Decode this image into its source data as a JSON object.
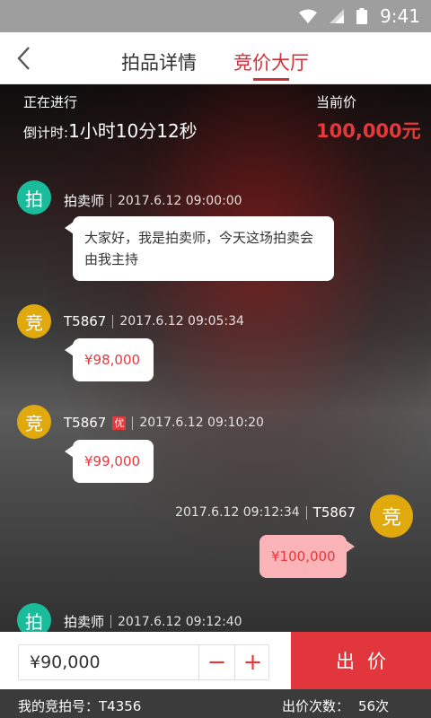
{
  "status_bar": {
    "time": "9:41",
    "icons": [
      "wifi-icon",
      "signal-icon",
      "battery-icon"
    ]
  },
  "nav": {
    "tabs": [
      {
        "label": "拍品详情",
        "active": false
      },
      {
        "label": "竞价大厅",
        "active": true
      }
    ]
  },
  "auction": {
    "status": "正在进行",
    "countdown_label": "倒计时:",
    "countdown_value": "1小时10分12秒",
    "price_label": "当前价",
    "current_price": "100,000元"
  },
  "messages": [
    {
      "avatar": "拍",
      "name": "拍卖师",
      "badge": "",
      "time": "2017.6.12  09:00:00",
      "text": "大家好，我是拍卖师，今天这场拍卖会由我主持"
    },
    {
      "avatar": "竞",
      "name": "T5867",
      "badge": "",
      "time": "2017.6.12  09:05:34",
      "text": "¥98,000"
    },
    {
      "avatar": "竞",
      "name": "T5867",
      "badge": "优",
      "time": "2017.6.12  09:10:20",
      "text": "¥99,000"
    },
    {
      "avatar": "竞",
      "name": "T5867",
      "badge": "",
      "time": "2017.6.12  09:12:34",
      "text": "¥100,000",
      "mine": true
    },
    {
      "avatar": "拍",
      "name": "拍卖师",
      "badge": "",
      "time": "2017.6.12  09:12:40",
      "text": ""
    }
  ],
  "bid_input": {
    "value": "¥90,000",
    "minus": "−",
    "plus": "+",
    "submit": "出价"
  },
  "footer": {
    "my_number_label": "我的竞拍号：",
    "my_number": "T4356",
    "bid_count_label": "出价次数：",
    "bid_count": "56次"
  },
  "colors": {
    "accent": "#e4393c",
    "teal": "#1abc9c",
    "gold": "#e0a90e",
    "my_bubble": "#fab4b8"
  }
}
